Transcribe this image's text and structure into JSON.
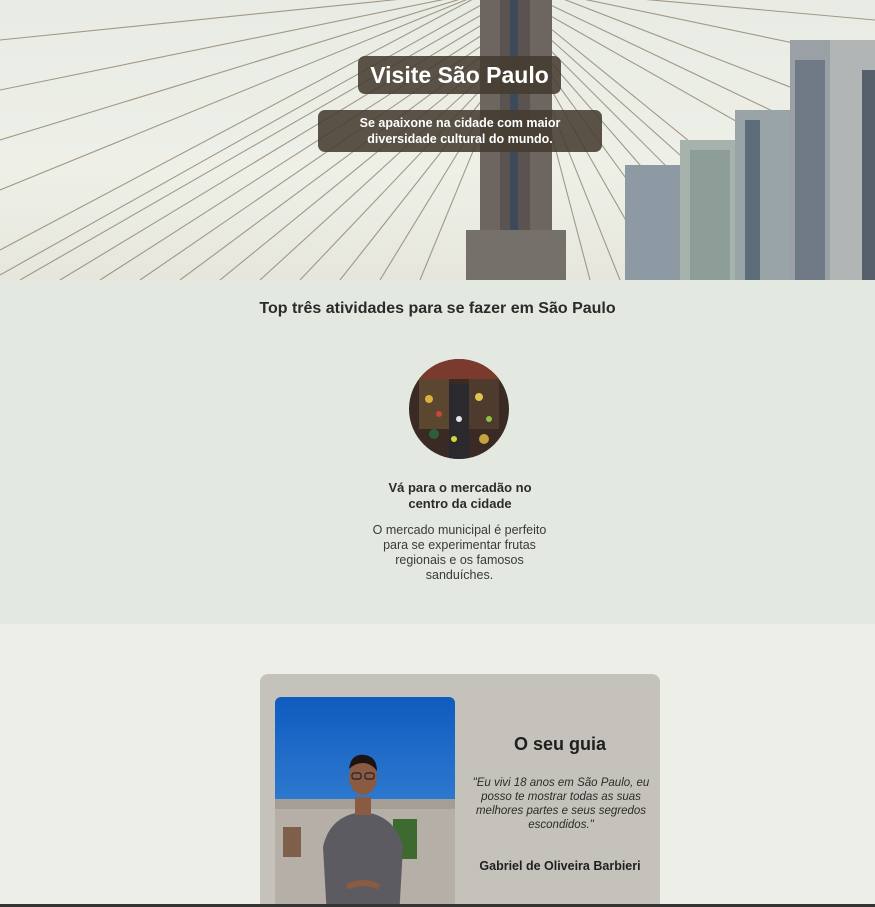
{
  "hero": {
    "title": "Visite São Paulo",
    "subtitle_line1": "Se apaixone na cidade com maior",
    "subtitle_line2": "diversidade cultural do mundo."
  },
  "activities": {
    "heading": "Top três atividades para se fazer em São Paulo",
    "items": [
      {
        "name_line1": "Vá para o mercadão no",
        "name_line2": "centro da cidade",
        "desc_line1": "O mercado municipal é perfeito",
        "desc_line2": "para se experimentar frutas",
        "desc_line3": "regionais e os famosos",
        "desc_line4": "sanduíches."
      }
    ]
  },
  "guide": {
    "title": "O seu guia",
    "quote_line1": "\"Eu vivi 18 anos em São Paulo, eu",
    "quote_line2": "posso te mostrar todas as suas",
    "quote_line3": "melhores partes e seus segredos",
    "quote_line4": "escondidos.\"",
    "name": "Gabriel de Oliveira Barbieri"
  },
  "colors": {
    "hero_label_bg": "#463c30",
    "activities_bg": "#e3e8e1",
    "page_bg": "#eeeee8",
    "guide_card_bg": "#c4c2bb"
  }
}
